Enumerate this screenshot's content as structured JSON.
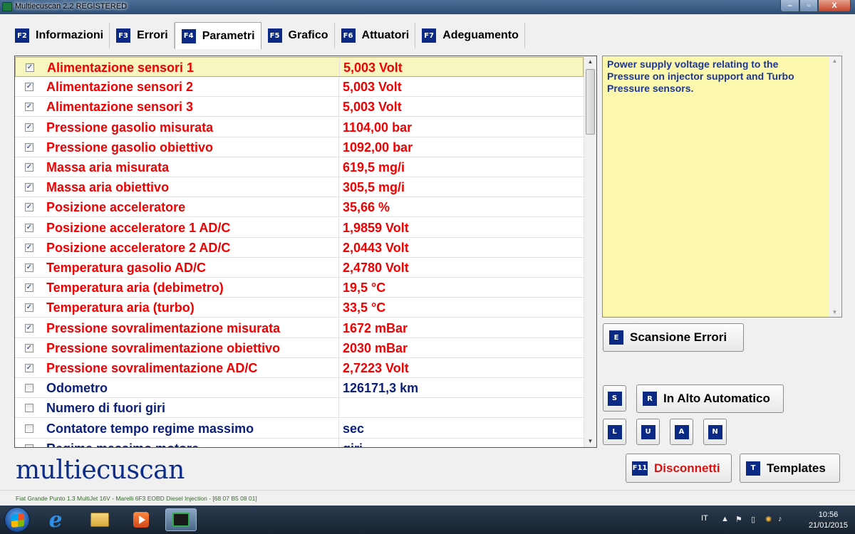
{
  "window": {
    "title": "Multiecuscan 2.2 REGISTERED",
    "min_label": "–",
    "max_label": "▫",
    "close_label": "X"
  },
  "tabs": [
    {
      "key": "F2",
      "label": "Informazioni",
      "active": false
    },
    {
      "key": "F3",
      "label": "Errori",
      "active": false
    },
    {
      "key": "F4",
      "label": "Parametri",
      "active": true
    },
    {
      "key": "F5",
      "label": "Grafico",
      "active": false
    },
    {
      "key": "F6",
      "label": "Attuatori",
      "active": false
    },
    {
      "key": "F7",
      "label": "Adeguamento",
      "active": false
    }
  ],
  "parameters": [
    {
      "checked": true,
      "name": "Alimentazione sensori 1",
      "value": "5,003 Volt",
      "color": "red"
    },
    {
      "checked": true,
      "name": "Alimentazione sensori 2",
      "value": "5,003 Volt",
      "color": "red"
    },
    {
      "checked": true,
      "name": "Alimentazione sensori 3",
      "value": "5,003 Volt",
      "color": "red"
    },
    {
      "checked": true,
      "name": "Pressione gasolio misurata",
      "value": "1104,00 bar",
      "color": "red"
    },
    {
      "checked": true,
      "name": "Pressione gasolio obiettivo",
      "value": "1092,00 bar",
      "color": "red"
    },
    {
      "checked": true,
      "name": "Massa aria misurata",
      "value": "619,5 mg/i",
      "color": "red"
    },
    {
      "checked": true,
      "name": "Massa aria obiettivo",
      "value": "305,5 mg/i",
      "color": "red"
    },
    {
      "checked": true,
      "name": "Posizione acceleratore",
      "value": "35,66 %",
      "color": "red"
    },
    {
      "checked": true,
      "name": "Posizione acceleratore 1 AD/C",
      "value": "1,9859 Volt",
      "color": "red"
    },
    {
      "checked": true,
      "name": "Posizione acceleratore 2 AD/C",
      "value": "2,0443 Volt",
      "color": "red"
    },
    {
      "checked": true,
      "name": "Temperatura gasolio AD/C",
      "value": "2,4780 Volt",
      "color": "red"
    },
    {
      "checked": true,
      "name": "Temperatura aria (debimetro)",
      "value": "19,5 °C",
      "color": "red"
    },
    {
      "checked": true,
      "name": "Temperatura aria (turbo)",
      "value": "33,5 °C",
      "color": "red"
    },
    {
      "checked": true,
      "name": "Pressione sovralimentazione misurata",
      "value": "1672 mBar",
      "color": "red"
    },
    {
      "checked": true,
      "name": "Pressione sovralimentazione obiettivo",
      "value": "2030 mBar",
      "color": "red"
    },
    {
      "checked": true,
      "name": "Pressione sovralimentazione AD/C",
      "value": "2,7223 Volt",
      "color": "red"
    },
    {
      "checked": false,
      "name": "Odometro",
      "value": "126171,3 km",
      "color": "blue"
    },
    {
      "checked": false,
      "name": "Numero di fuori giri",
      "value": "",
      "color": "blue"
    },
    {
      "checked": false,
      "name": "Contatore tempo regime massimo",
      "value": " sec",
      "color": "blue"
    },
    {
      "checked": false,
      "name": "Regime massimo motore",
      "value": " giri",
      "color": "blue"
    }
  ],
  "selected_row": 0,
  "description": "Power supply voltage relating to the Pressure on injector support and Turbo Pressure sensors.",
  "buttons": {
    "scan_errors": {
      "key": "E",
      "label": "Scansione Errori"
    },
    "s_key": "S",
    "top_auto": {
      "key": "R",
      "label": "In Alto Automatico"
    },
    "l_key": "L",
    "u_key": "U",
    "a_key": "A",
    "n_key": "N",
    "disconnect": {
      "key": "F11",
      "label": "Disconnetti"
    },
    "templates": {
      "key": "T",
      "label": "Templates"
    }
  },
  "logo": "multiecuscan",
  "status": "Fiat Grande Punto 1.3 MultiJet 16V - Marelli 6F3 EOBD Diesel Injection - [68 07 B5 08 01]",
  "taskbar": {
    "lang": "IT",
    "time": "10:56",
    "date": "21/01/2015"
  },
  "colors": {
    "red": "#f00000",
    "blue": "#0b1f7a",
    "accent": "#0a2a86",
    "desc_bg": "#fbf8ad",
    "selected_bg": "#f8f6bf"
  }
}
